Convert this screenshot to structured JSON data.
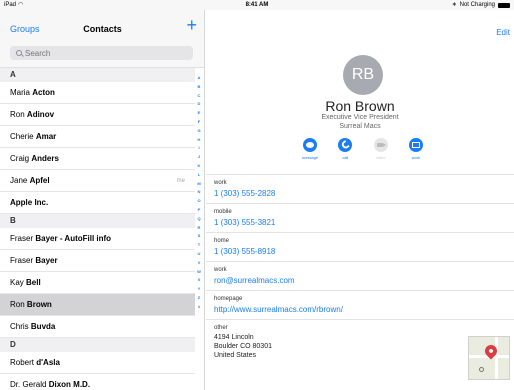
{
  "status_bar": {
    "device": "iPad",
    "time": "8:41 AM",
    "charging": "Not Charging"
  },
  "left_nav": {
    "groups_label": "Groups",
    "title": "Contacts",
    "add_label": "+"
  },
  "search": {
    "placeholder": "Search"
  },
  "contacts": [
    {
      "type": "section",
      "text": "A"
    },
    {
      "type": "contact",
      "first": "Maria",
      "last": "Acton",
      "selected": false,
      "me": ""
    },
    {
      "type": "contact",
      "first": "Ron",
      "last": "Adinov",
      "selected": false,
      "me": ""
    },
    {
      "type": "contact",
      "first": "Cherie",
      "last": "Amar",
      "selected": false,
      "me": ""
    },
    {
      "type": "contact",
      "first": "Craig",
      "last": "Anders",
      "selected": false,
      "me": ""
    },
    {
      "type": "contact",
      "first": "Jane",
      "last": "Apfel",
      "selected": false,
      "me": "me"
    },
    {
      "type": "contact",
      "first": "",
      "last": "Apple Inc.",
      "selected": false,
      "me": ""
    },
    {
      "type": "section",
      "text": "B"
    },
    {
      "type": "contact",
      "first": "Fraser",
      "last": "Bayer - AutoFill info",
      "selected": false,
      "me": ""
    },
    {
      "type": "contact",
      "first": "Fraser",
      "last": "Bayer",
      "selected": false,
      "me": ""
    },
    {
      "type": "contact",
      "first": "Kay",
      "last": "Bell",
      "selected": false,
      "me": ""
    },
    {
      "type": "contact",
      "first": "Ron",
      "last": "Brown",
      "selected": true,
      "me": ""
    },
    {
      "type": "contact",
      "first": "Chris",
      "last": "Buvda",
      "selected": false,
      "me": ""
    },
    {
      "type": "section",
      "text": "D"
    },
    {
      "type": "contact",
      "first": "Robert",
      "last": "d'Asla",
      "selected": false,
      "me": ""
    },
    {
      "type": "contact",
      "first": "Dr. Gerald",
      "last": "Dixon M.D.",
      "selected": false,
      "me": ""
    }
  ],
  "index_letters": [
    "A",
    "B",
    "C",
    "D",
    "E",
    "F",
    "G",
    "H",
    "I",
    "J",
    "K",
    "L",
    "M",
    "N",
    "O",
    "P",
    "Q",
    "R",
    "S",
    "T",
    "U",
    "V",
    "W",
    "X",
    "Y",
    "Z",
    "#"
  ],
  "detail": {
    "edit_label": "Edit",
    "initials": "RB",
    "name": "Ron Brown",
    "job_title": "Executive Vice President",
    "company": "Surreal Macs",
    "actions": [
      {
        "label": "message",
        "icon": "message-icon",
        "enabled": true
      },
      {
        "label": "call",
        "icon": "phone-icon",
        "enabled": true
      },
      {
        "label": "video",
        "icon": "video-icon",
        "enabled": false
      },
      {
        "label": "work",
        "icon": "mail-icon",
        "enabled": true
      }
    ],
    "fields": [
      {
        "label": "work",
        "value": "1 (303) 555-2828"
      },
      {
        "label": "mobile",
        "value": "1 (303) 555-3821"
      },
      {
        "label": "home",
        "value": "1 (303) 555-8918"
      },
      {
        "label": "work",
        "value": "ron@surrealmacs.com"
      },
      {
        "label": "homepage",
        "value": "http://www.surrealmacs.com/rbrown/"
      }
    ],
    "address": {
      "label": "other",
      "line1": "4194 Lincoln",
      "line2": "Boulder CO 80301",
      "line3": "United States"
    }
  },
  "colors": {
    "accent": "#1a7ef2",
    "avatar": "#a7aab1",
    "selected_row": "#d3d3d6",
    "map_pin": "#e0393e"
  }
}
